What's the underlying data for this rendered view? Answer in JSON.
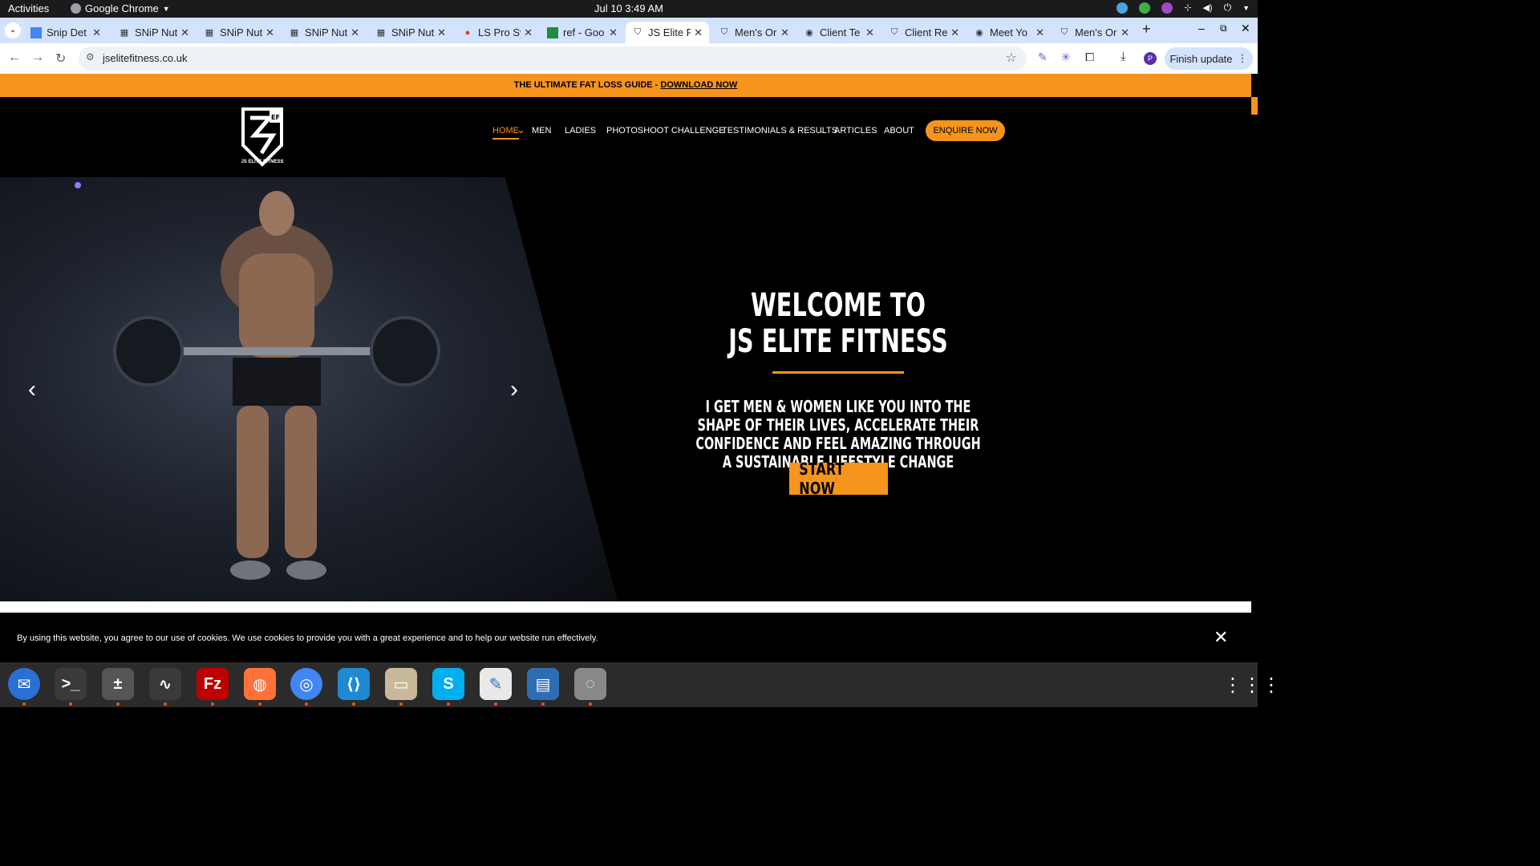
{
  "system_bar": {
    "activities": "Activities",
    "app_name": "Google Chrome",
    "clock": "Jul 10  3:49 AM"
  },
  "tabs": [
    {
      "title": "Snip Det",
      "icon": "docs-icon"
    },
    {
      "title": "SNiP Nut",
      "icon": "snip-icon"
    },
    {
      "title": "SNiP Nut",
      "icon": "snip-icon"
    },
    {
      "title": "SNiP Nut",
      "icon": "snip-icon"
    },
    {
      "title": "SNiP Nut",
      "icon": "snip-icon"
    },
    {
      "title": "LS Pro Sy",
      "icon": "ls-pro-icon"
    },
    {
      "title": "ref - Goo",
      "icon": "sheets-icon"
    },
    {
      "title": "JS Elite F",
      "icon": "shield-icon",
      "active": true
    },
    {
      "title": "Men's Or",
      "icon": "shield-icon"
    },
    {
      "title": "Client Te",
      "icon": "client-icon"
    },
    {
      "title": "Client Re",
      "icon": "shield-icon"
    },
    {
      "title": "Meet Yo",
      "icon": "meet-icon"
    },
    {
      "title": "Men's Or",
      "icon": "shield-icon"
    }
  ],
  "toolbar": {
    "url": "jselitefitness.co.uk",
    "finish_update": "Finish update",
    "profile_initial": "P"
  },
  "site": {
    "promo": "THE ULTIMATE FAT LOSS GUIDE - ",
    "promo_link": "DOWNLOAD NOW",
    "logo_text": "JS ELITE FITNESS",
    "logo_mark": "EF",
    "nav": [
      "HOME",
      "MEN",
      "LADIES",
      "PHOTOSHOOT CHALLENGE",
      "TESTIMONIALS & RESULTS",
      "ARTICLES",
      "ABOUT"
    ],
    "enquire": "ENQUIRE NOW",
    "hero": {
      "title_1": "WELCOME TO",
      "title_2": "JS ELITE FITNESS",
      "subtitle": "I GET MEN & WOMEN LIKE YOU INTO THE SHAPE OF THEIR LIVES, ACCELERATE THEIR CONFIDENCE AND FEEL AMAZING THROUGH A SUSTAINABLE LIFESTYLE CHANGE",
      "cta": "START NOW"
    },
    "cookie": "By using this website, you agree to our use of cookies. We use cookies to provide you with a great experience and to help our website run effectively."
  },
  "dock": [
    {
      "name": "thunderbird-icon",
      "color": "#2a6fd6"
    },
    {
      "name": "terminal-icon",
      "color": "#3a3a3a"
    },
    {
      "name": "calculator-icon",
      "color": "#555555"
    },
    {
      "name": "system-monitor-icon",
      "color": "#3a3a3a"
    },
    {
      "name": "filezilla-icon",
      "color": "#bf0000"
    },
    {
      "name": "firefox-icon",
      "color": "#ff7139"
    },
    {
      "name": "chrome-icon",
      "color": "#4285f4"
    },
    {
      "name": "vscode-icon",
      "color": "#1f8ad2"
    },
    {
      "name": "files-icon",
      "color": "#c7b99a"
    },
    {
      "name": "skype-icon",
      "color": "#00aff0"
    },
    {
      "name": "text-editor-icon",
      "color": "#e9e9e9"
    },
    {
      "name": "document-viewer-icon",
      "color": "#2e6db4"
    },
    {
      "name": "disk-icon",
      "color": "#888888"
    }
  ],
  "colors": {
    "accent": "#f7941d",
    "tab_strip": "#d3e3fd"
  }
}
